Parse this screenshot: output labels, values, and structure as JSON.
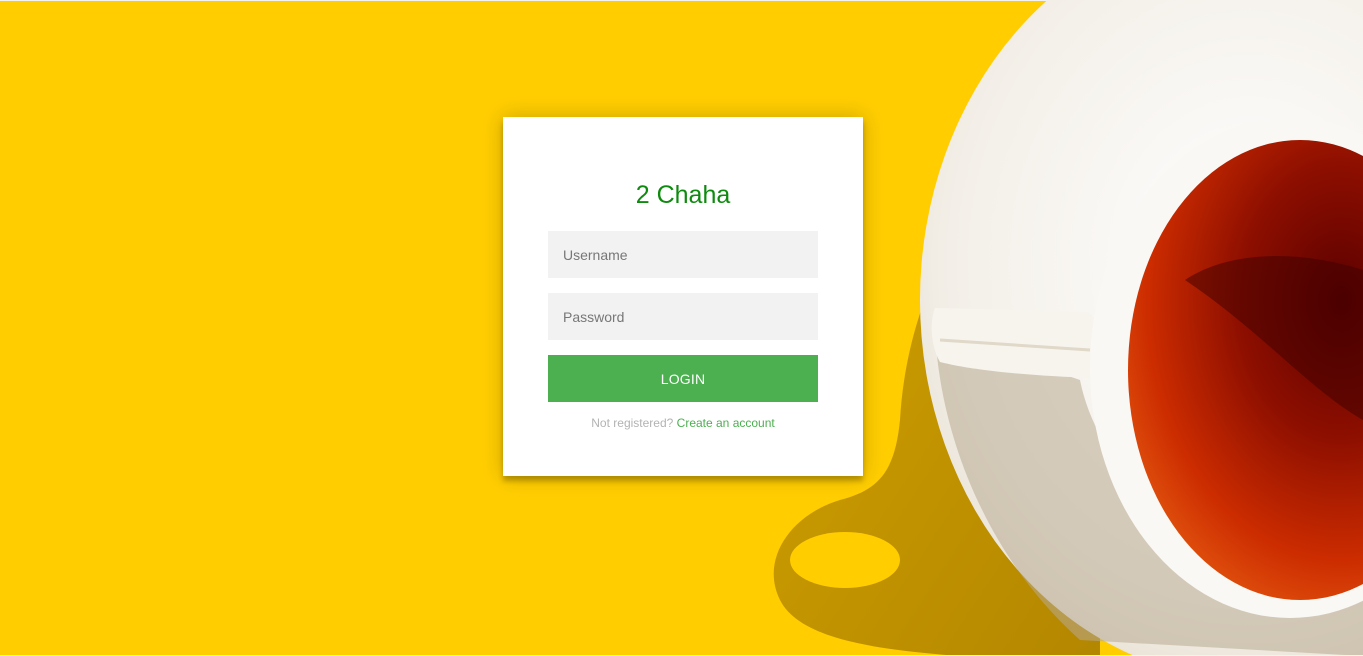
{
  "brand": {
    "title": "2 Chaha"
  },
  "form": {
    "username_placeholder": "Username",
    "password_placeholder": "Password",
    "login_label": "LOGIN"
  },
  "register": {
    "prompt": "Not registered?",
    "link_label": "Create an account"
  },
  "colors": {
    "background": "#ffcd00",
    "accent": "#4caf50",
    "title": "#0e8a0e"
  }
}
